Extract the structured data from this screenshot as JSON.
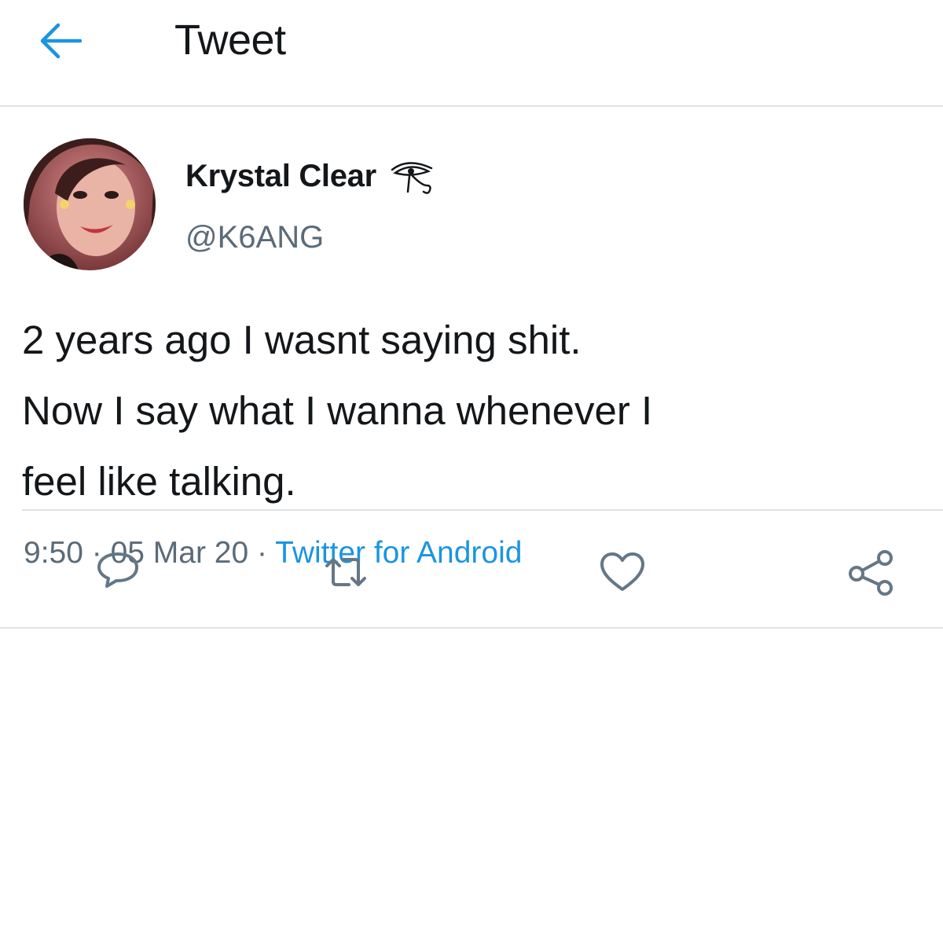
{
  "header": {
    "title": "Tweet",
    "back_icon": "arrow-left-icon"
  },
  "colors": {
    "accent": "#1b95e0",
    "text_primary": "#14171a",
    "text_secondary": "#5b6b78",
    "divider": "#dfe3e7"
  },
  "tweet": {
    "author": {
      "display_name": "Krystal Clear",
      "name_glyph": "eye-of-horus-icon",
      "handle": "@K6ANG",
      "avatar": "avatar-photo"
    },
    "text": "2 years ago I wasnt saying shit.\nNow I say what I wanna whenever I\nfeel like talking.",
    "time": "9:50",
    "separator": " · ",
    "date": "05 Mar 20",
    "source": "Twitter for Android"
  },
  "actions": [
    {
      "name": "reply",
      "icon": "reply-icon"
    },
    {
      "name": "retweet",
      "icon": "retweet-icon"
    },
    {
      "name": "like",
      "icon": "heart-icon"
    },
    {
      "name": "share",
      "icon": "share-icon"
    }
  ]
}
